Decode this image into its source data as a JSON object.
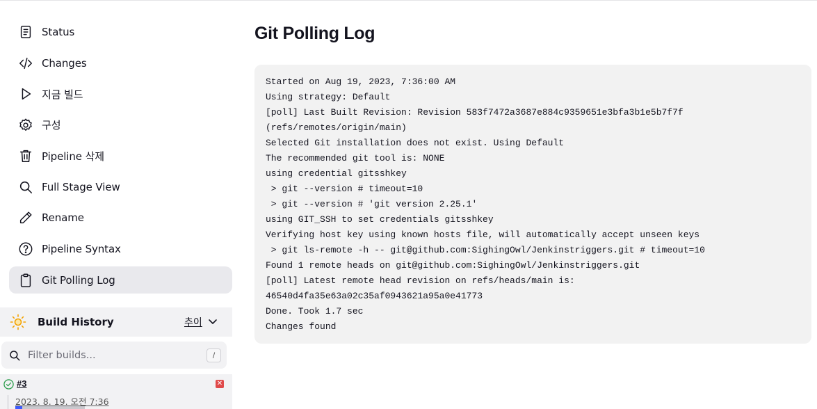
{
  "sidebar": {
    "items": [
      {
        "label": "Status",
        "icon": "document-icon"
      },
      {
        "label": "Changes",
        "icon": "code-icon"
      },
      {
        "label": "지금 빌드",
        "icon": "play-icon"
      },
      {
        "label": "구성",
        "icon": "gear-icon"
      },
      {
        "label": "Pipeline 삭제",
        "icon": "trash-icon"
      },
      {
        "label": "Full Stage View",
        "icon": "search-icon"
      },
      {
        "label": "Rename",
        "icon": "pencil-icon"
      },
      {
        "label": "Pipeline Syntax",
        "icon": "help-circle-icon"
      },
      {
        "label": "Git Polling Log",
        "icon": "clipboard-icon",
        "active": true
      }
    ]
  },
  "build_history": {
    "title": "Build History",
    "trend_label": "추이",
    "filter_placeholder": "Filter builds...",
    "filter_shortcut": "/",
    "builds": [
      {
        "number": "#3",
        "date": "2023. 8. 19. 오전 7:36",
        "status": "success"
      }
    ]
  },
  "main": {
    "title": "Git Polling Log",
    "log_lines": [
      "Started on Aug 19, 2023, 7:36:00 AM",
      "Using strategy: Default",
      "[poll] Last Built Revision: Revision 583f7472a3687e884c9359651e3bfa3b1e5b7f7f",
      "(refs/remotes/origin/main)",
      "Selected Git installation does not exist. Using Default",
      "The recommended git tool is: NONE",
      "using credential gitsshkey",
      " > git --version # timeout=10",
      " > git --version # 'git version 2.25.1'",
      "using GIT_SSH to set credentials gitsshkey",
      "Verifying host key using known hosts file, will automatically accept unseen keys",
      " > git ls-remote -h -- git@github.com:SighingOwl/Jenkinstriggers.git # timeout=10",
      "Found 1 remote heads on git@github.com:SighingOwl/Jenkinstriggers.git",
      "[poll] Latest remote head revision on refs/heads/main is:",
      "46540d4fa35e63a02c35af0943621a95a0e41773",
      "Done. Took 1.7 sec",
      "Changes found"
    ]
  },
  "colors": {
    "active_bg": "#e9e9ed",
    "console_bg": "#f2f2f2",
    "sun": "#f2a100",
    "success": "#2e9e4e",
    "failure": "#e04a4a"
  }
}
